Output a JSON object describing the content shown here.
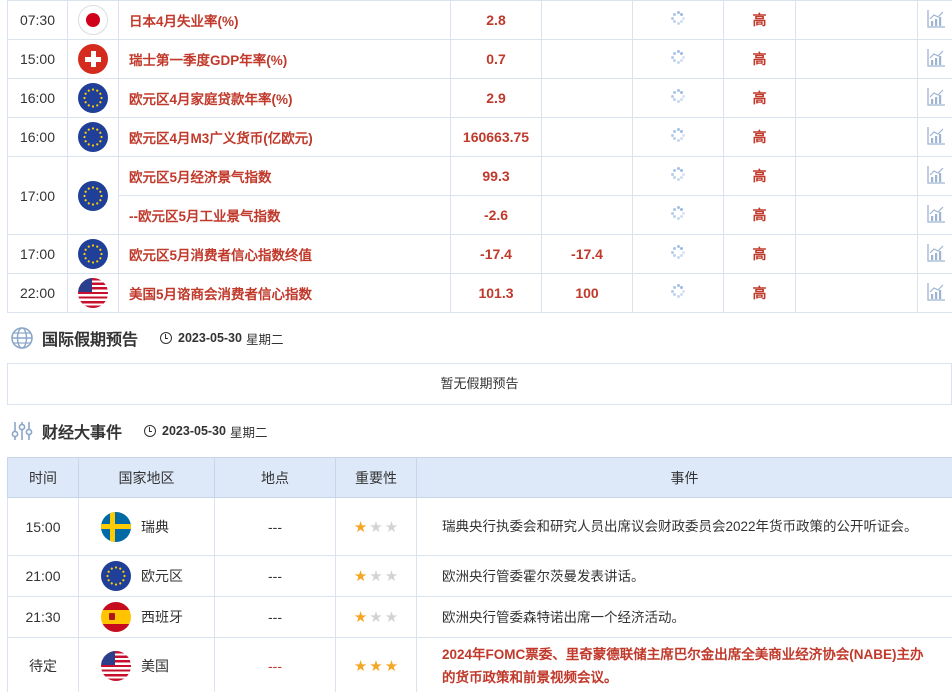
{
  "calendar_rows": [
    {
      "time": "07:30",
      "flag": "japan-flag-icon",
      "indicator": "日本4月失业率(%)",
      "previous": "2.8",
      "forecast": "",
      "importance": "高"
    },
    {
      "time": "15:00",
      "flag": "switzerland-flag-icon",
      "indicator": "瑞士第一季度GDP年率(%)",
      "previous": "0.7",
      "forecast": "",
      "importance": "高"
    },
    {
      "time": "16:00",
      "flag": "eu-flag-icon",
      "indicator": "欧元区4月家庭贷款年率(%)",
      "previous": "2.9",
      "forecast": "",
      "importance": "高"
    },
    {
      "time": "16:00",
      "flag": "eu-flag-icon",
      "indicator": "欧元区4月M3广义货币(亿欧元)",
      "previous": "160663.75",
      "forecast": "",
      "importance": "高"
    },
    {
      "time": "17:00",
      "flag": "eu-flag-icon",
      "indicator": "欧元区5月经济景气指数",
      "previous": "99.3",
      "forecast": "",
      "importance": "高"
    },
    {
      "time": "",
      "flag": "",
      "indicator": "--欧元区5月工业景气指数",
      "previous": "-2.6",
      "forecast": "",
      "importance": "高"
    },
    {
      "time": "17:00",
      "flag": "eu-flag-icon",
      "indicator": "欧元区5月消费者信心指数终值",
      "previous": "-17.4",
      "forecast": "-17.4",
      "importance": "高"
    },
    {
      "time": "22:00",
      "flag": "usa-flag-icon",
      "indicator": "美国5月谘商会消费者信心指数",
      "previous": "101.3",
      "forecast": "100",
      "importance": "高"
    }
  ],
  "holiday": {
    "title": "国际假期预告",
    "date": "2023-05-30",
    "weekday": "星期二",
    "empty_text": "暂无假期预告"
  },
  "events": {
    "title": "财经大事件",
    "date": "2023-05-30",
    "weekday": "星期二",
    "headers": [
      "时间",
      "国家地区",
      "地点",
      "重要性",
      "事件"
    ],
    "rows": [
      {
        "time": "15:00",
        "flag": "sweden-flag-icon",
        "country": "瑞典",
        "place": "---",
        "stars": 1,
        "event": "瑞典央行执委会和研究人员出席议会财政委员会2022年货币政策的公开听证会。"
      },
      {
        "time": "21:00",
        "flag": "eu-flag-icon",
        "country": "欧元区",
        "place": "---",
        "stars": 1,
        "event": "欧洲央行管委霍尔茨曼发表讲话。"
      },
      {
        "time": "21:30",
        "flag": "spain-flag-icon",
        "country": "西班牙",
        "place": "---",
        "stars": 1,
        "event": "欧洲央行管委森特诺出席一个经济活动。"
      },
      {
        "time": "待定",
        "flag": "usa-flag-icon",
        "country": "美国",
        "place": "---",
        "stars": 3,
        "event": "2024年FOMC票委、里奇蒙德联储主席巴尔金出席全美商业经济协会(NABE)主办的货币政策和前景视频会议。"
      }
    ]
  },
  "colors": {
    "accent_red": "#c0392b",
    "header_bg": "#dde9f8",
    "star_on": "#f5a623",
    "star_off": "#d3d3d3"
  }
}
